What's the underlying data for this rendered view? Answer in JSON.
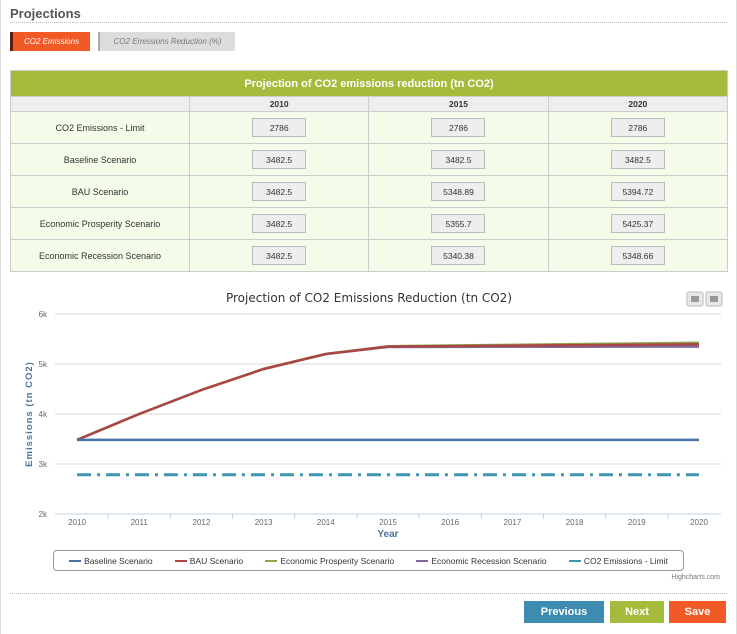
{
  "section_title": "Projections",
  "tabs": [
    {
      "label": "CO2 Emissions",
      "active": true
    },
    {
      "label": "CO2 Emissions Reduction (%)",
      "active": false
    }
  ],
  "table": {
    "title": "Projection of CO2 emissions reduction (tn CO2)",
    "years": [
      "2010",
      "2015",
      "2020"
    ],
    "rows": [
      {
        "label": "CO2 Emissions - Limit",
        "values": [
          "2786",
          "2786",
          "2786"
        ]
      },
      {
        "label": "Baseline Scenario",
        "values": [
          "3482.5",
          "3482.5",
          "3482.5"
        ]
      },
      {
        "label": "BAU Scenario",
        "values": [
          "3482.5",
          "5348.89",
          "5394.72"
        ]
      },
      {
        "label": "Economic Prosperity Scenario",
        "values": [
          "3482.5",
          "5355.7",
          "5425.37"
        ]
      },
      {
        "label": "Economic Recession Scenario",
        "values": [
          "3482.5",
          "5340.38",
          "5348.66"
        ]
      }
    ]
  },
  "chart_data": {
    "type": "line",
    "title": "Projection of CO2 Emissions Reduction (tn CO2)",
    "xlabel": "Year",
    "ylabel": "Emissions (tn CO2)",
    "x": [
      2010,
      2011,
      2012,
      2013,
      2014,
      2015,
      2016,
      2017,
      2018,
      2019,
      2020
    ],
    "ylim": [
      2000,
      6000
    ],
    "yticks": [
      "2k",
      "3k",
      "4k",
      "5k",
      "6k"
    ],
    "grid": true,
    "legend": "bottom",
    "series": [
      {
        "name": "Baseline Scenario",
        "color": "#4572a7",
        "values": [
          3482.5,
          3482.5,
          3482.5,
          3482.5,
          3482.5,
          3482.5,
          3482.5,
          3482.5,
          3482.5,
          3482.5,
          3482.5
        ]
      },
      {
        "name": "BAU Scenario",
        "color": "#aa4643",
        "values": [
          3482.5,
          4000,
          4480,
          4900,
          5200,
          5348.89,
          5358,
          5367,
          5376,
          5385,
          5394.72
        ]
      },
      {
        "name": "Economic Prosperity Scenario",
        "color": "#89a54e",
        "values": [
          3482.5,
          4000,
          4480,
          4900,
          5200,
          5355.7,
          5369,
          5383,
          5397,
          5411,
          5425.37
        ]
      },
      {
        "name": "Economic Recession Scenario",
        "color": "#80699b",
        "values": [
          3482.5,
          4000,
          4480,
          4900,
          5200,
          5340.38,
          5342,
          5344,
          5345,
          5347,
          5348.66
        ]
      },
      {
        "name": "CO2 Emissions - Limit",
        "color": "#3d96ae",
        "dash": true,
        "values": [
          2786,
          2786,
          2786,
          2786,
          2786,
          2786,
          2786,
          2786,
          2786,
          2786,
          2786
        ]
      }
    ]
  },
  "credit": "Highcharts.com",
  "buttons": {
    "previous": "Previous",
    "next": "Next",
    "save": "Save"
  }
}
